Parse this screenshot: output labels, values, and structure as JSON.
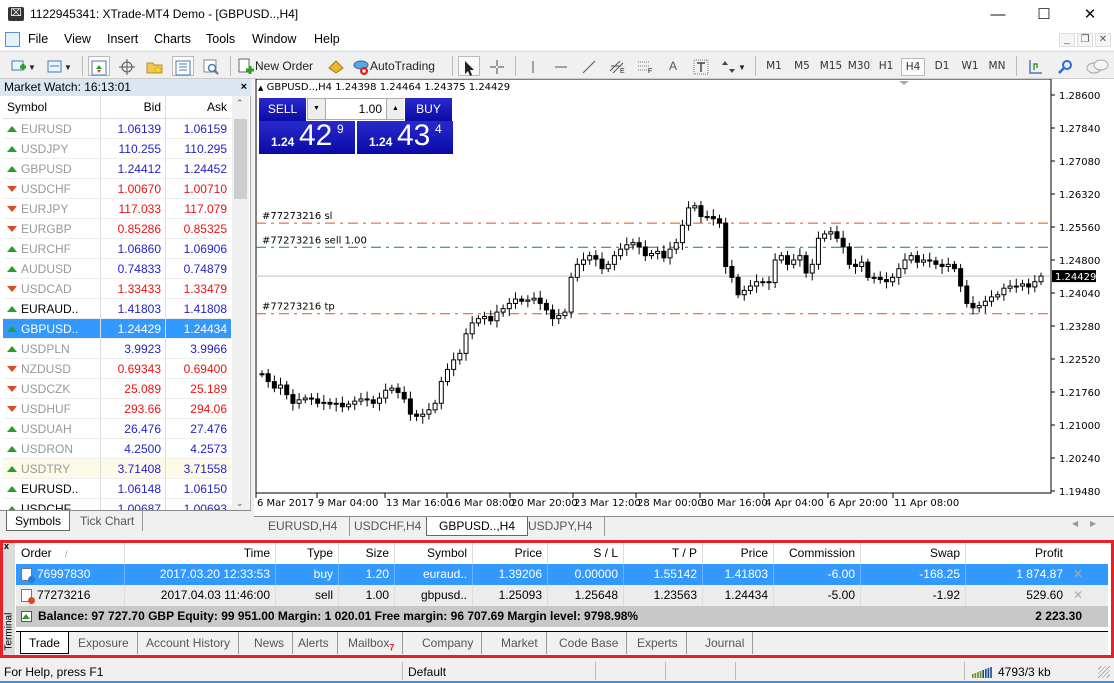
{
  "window": {
    "title": "1122945341: XTrade-MT4 Demo - [GBPUSD..,H4]",
    "controls": {
      "minimize": "—",
      "maximize": "☐",
      "close": "✕"
    },
    "mdi_controls": {
      "minimize": "_",
      "restore": "❐",
      "close": "✕"
    }
  },
  "menu": [
    "File",
    "View",
    "Insert",
    "Charts",
    "Tools",
    "Window",
    "Help"
  ],
  "toolbar": {
    "new_order": "New Order",
    "auto_trading": "AutoTrading",
    "drawing_labels": {
      "fibo_e": "E",
      "fibo_f": "F",
      "text": "A",
      "label": "T"
    },
    "timeframes": [
      "M1",
      "M5",
      "M15",
      "M30",
      "H1",
      "H4",
      "D1",
      "W1",
      "MN"
    ],
    "active_timeframe": "H4"
  },
  "market_watch": {
    "title": "Market Watch: 16:13:01",
    "close": "×",
    "headers": {
      "symbol": "Symbol",
      "bid": "Bid",
      "ask": "Ask"
    },
    "rows": [
      {
        "symbol": "EURUSD",
        "bid": "1.06139",
        "ask": "1.06159",
        "dir": "up",
        "dim": true
      },
      {
        "symbol": "USDJPY",
        "bid": "110.255",
        "ask": "110.295",
        "dir": "up",
        "dim": true
      },
      {
        "symbol": "GBPUSD",
        "bid": "1.24412",
        "ask": "1.24452",
        "dir": "up",
        "dim": true
      },
      {
        "symbol": "USDCHF",
        "bid": "1.00670",
        "ask": "1.00710",
        "dir": "down",
        "dim": true
      },
      {
        "symbol": "EURJPY",
        "bid": "117.033",
        "ask": "117.079",
        "dir": "down",
        "dim": true
      },
      {
        "symbol": "EURGBP",
        "bid": "0.85286",
        "ask": "0.85325",
        "dir": "down",
        "dim": true
      },
      {
        "symbol": "EURCHF",
        "bid": "1.06860",
        "ask": "1.06906",
        "dir": "up",
        "dim": true
      },
      {
        "symbol": "AUDUSD",
        "bid": "0.74833",
        "ask": "0.74879",
        "dir": "up",
        "dim": true
      },
      {
        "symbol": "USDCAD",
        "bid": "1.33433",
        "ask": "1.33479",
        "dir": "down",
        "dim": true
      },
      {
        "symbol": "EURAUD..",
        "bid": "1.41803",
        "ask": "1.41808",
        "dir": "up",
        "dim": false
      },
      {
        "symbol": "GBPUSD..",
        "bid": "1.24429",
        "ask": "1.24434",
        "dir": "up",
        "dim": false,
        "selected": true
      },
      {
        "symbol": "USDPLN",
        "bid": "3.9923",
        "ask": "3.9966",
        "dir": "up",
        "dim": true
      },
      {
        "symbol": "NZDUSD",
        "bid": "0.69343",
        "ask": "0.69400",
        "dir": "down",
        "dim": true
      },
      {
        "symbol": "USDCZK",
        "bid": "25.089",
        "ask": "25.189",
        "dir": "down",
        "dim": true
      },
      {
        "symbol": "USDHUF",
        "bid": "293.66",
        "ask": "294.06",
        "dir": "down",
        "dim": true
      },
      {
        "symbol": "USDUAH",
        "bid": "26.476",
        "ask": "27.476",
        "dir": "up",
        "dim": true
      },
      {
        "symbol": "USDRON",
        "bid": "4.2500",
        "ask": "4.2573",
        "dir": "up",
        "dim": true
      },
      {
        "symbol": "USDTRY",
        "bid": "3.71408",
        "ask": "3.71558",
        "dir": "up",
        "dim": true,
        "highlight": true
      },
      {
        "symbol": "EURUSD..",
        "bid": "1.06148",
        "ask": "1.06150",
        "dir": "up",
        "dim": false
      },
      {
        "symbol": "USDCHF..",
        "bid": "1.00687",
        "ask": "1.00693",
        "dir": "up",
        "dim": false
      }
    ],
    "tabs": [
      "Symbols",
      "Tick Chart"
    ],
    "active_tab": "Symbols"
  },
  "chart": {
    "header": "GBPUSD..,H4  1.24398 1.24464 1.24375 1.24429",
    "one_click": {
      "sell_label": "SELL",
      "buy_label": "BUY",
      "volume": "1.00",
      "sell_price_prefix": "1.24",
      "sell_price_big": "42",
      "sell_price_sup": "9",
      "buy_price_prefix": "1.24",
      "buy_price_big": "43",
      "buy_price_sup": "4"
    },
    "tabs": [
      "EURUSD,H4",
      "USDCHF,H4",
      "GBPUSD..,H4",
      "USDJPY,H4"
    ],
    "active_tab": "GBPUSD..,H4"
  },
  "chart_data": {
    "type": "line",
    "title": "GBPUSD..,H4",
    "subtitle": "1.24398 1.24464 1.24375 1.24429",
    "y_ticks": [
      "1.28600",
      "1.27840",
      "1.27080",
      "1.26320",
      "1.25560",
      "1.24800",
      "1.24040",
      "1.23280",
      "1.22520",
      "1.21760",
      "1.21000",
      "1.20240",
      "1.19480"
    ],
    "ylim": [
      1.1948,
      1.286
    ],
    "x_ticks": [
      "6 Mar 2017",
      "9 Mar 04:00",
      "13 Mar 16:00",
      "16 Mar 08:00",
      "20 Mar 20:00",
      "23 Mar 12:00",
      "28 Mar 00:00",
      "30 Mar 16:00",
      "4 Apr 04:00",
      "6 Apr 20:00",
      "11 Apr 08:00"
    ],
    "current_price": "1.24429",
    "levels": [
      {
        "label": "#77273216 sl",
        "price": 1.25648,
        "color": "#e8501a"
      },
      {
        "label": "#77273216 sell 1.00",
        "price": 1.25093,
        "color": "#1a8a1a"
      },
      {
        "label": "#77273216 tp",
        "price": 1.23563,
        "color": "#e8501a"
      }
    ],
    "close_series": [
      1.2218,
      1.22,
      1.2185,
      1.2192,
      1.217,
      1.215,
      1.2158,
      1.2162,
      1.216,
      1.215,
      1.2152,
      1.2148,
      1.215,
      1.2142,
      1.2148,
      1.2155,
      1.216,
      1.2158,
      1.215,
      1.2162,
      1.218,
      1.2185,
      1.2175,
      1.216,
      1.2125,
      1.212,
      1.2125,
      1.2135,
      1.215,
      1.22,
      1.2228,
      1.225,
      1.2265,
      1.231,
      1.2335,
      1.2345,
      1.235,
      1.234,
      1.236,
      1.2368,
      1.238,
      1.239,
      1.2385,
      1.2388,
      1.2392,
      1.238,
      1.2365,
      1.2345,
      1.2352,
      1.236,
      1.244,
      1.247,
      1.248,
      1.249,
      1.2482,
      1.246,
      1.247,
      1.249,
      1.2505,
      1.2515,
      1.252,
      1.251,
      1.249,
      1.2495,
      1.25,
      1.2485,
      1.2505,
      1.252,
      1.256,
      1.26,
      1.2605,
      1.258,
      1.258,
      1.2575,
      1.2565,
      1.2465,
      1.244,
      1.24,
      1.241,
      1.242,
      1.243,
      1.243,
      1.2428,
      1.248,
      1.249,
      1.247,
      1.248,
      1.249,
      1.245,
      1.247,
      1.253,
      1.254,
      1.2545,
      1.253,
      1.251,
      1.247,
      1.2465,
      1.2475,
      1.244,
      1.244,
      1.2435,
      1.243,
      1.244,
      1.246,
      1.248,
      1.249,
      1.2475,
      1.248,
      1.2478,
      1.247,
      1.2465,
      1.247,
      1.246,
      1.242,
      1.238,
      1.237,
      1.2375,
      1.2385,
      1.2395,
      1.24,
      1.2415,
      1.242,
      1.242,
      1.2425,
      1.2418,
      1.243,
      1.2443
    ]
  },
  "terminal": {
    "close": "x",
    "side_label": "Terminal",
    "headers": [
      "Order",
      "Time",
      "Type",
      "Size",
      "Symbol",
      "Price",
      "S / L",
      "T / P",
      "Price",
      "Commission",
      "Swap",
      "Profit"
    ],
    "sort_indicator": "/",
    "orders": [
      {
        "order": "76997830",
        "time": "2017.03.20 12:33:53",
        "type": "buy",
        "size": "1.20",
        "symbol": "euraud..",
        "price": "1.39206",
        "sl": "0.00000",
        "tp": "1.55142",
        "cur_price": "1.41803",
        "commission": "-6.00",
        "swap": "-168.25",
        "profit": "1 874.87",
        "selected": true
      },
      {
        "order": "77273216",
        "time": "2017.04.03 11:46:00",
        "type": "sell",
        "size": "1.00",
        "symbol": "gbpusd..",
        "price": "1.25093",
        "sl": "1.25648",
        "tp": "1.23563",
        "cur_price": "1.24434",
        "commission": "-5.00",
        "swap": "-1.92",
        "profit": "529.60",
        "selected": false
      }
    ],
    "summary": "Balance: 97 727.70 GBP  Equity: 99 951.00  Margin: 1 020.01  Free margin: 96 707.69  Margin level: 9798.98%",
    "total_profit": "2 223.30",
    "tabs": [
      "Trade",
      "Exposure",
      "Account History",
      "News",
      "Alerts",
      "Mailbox",
      "Company",
      "Market",
      "Code Base",
      "Experts",
      "Journal"
    ],
    "mailbox_badge": "7",
    "active_tab": "Trade"
  },
  "status": {
    "help": "For Help, press F1",
    "profile": "Default",
    "connection": "4793/3 kb"
  },
  "colors": {
    "accent_selection": "#3399ff",
    "one_click_blue": "#1010b8",
    "up_price": "#2222cc",
    "down_price": "#ee1111",
    "highlight_border": "#e8202a"
  }
}
